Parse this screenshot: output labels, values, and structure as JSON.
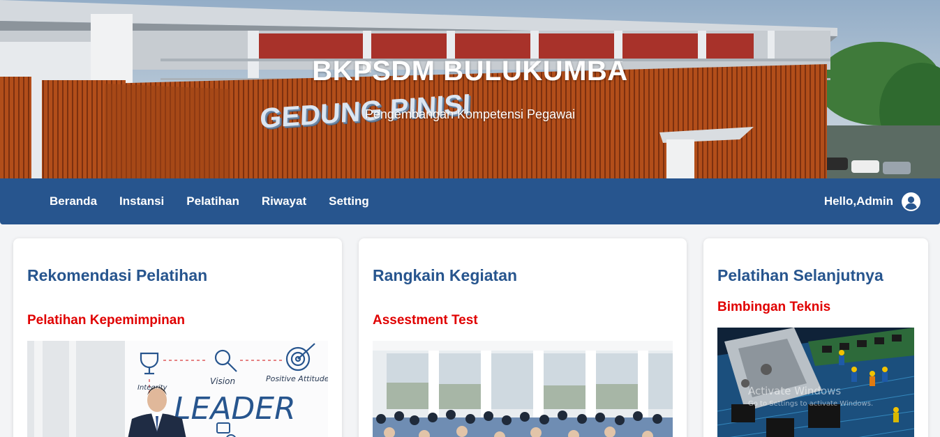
{
  "hero": {
    "title": "BKPSDM BULUKUMBA",
    "subtitle": "Pengembangan Kompetensi Pegawai",
    "building_sign": "GEDUNG PINISI"
  },
  "navbar": {
    "background": "#27558e",
    "links": [
      {
        "label": "Beranda"
      },
      {
        "label": "Instansi"
      },
      {
        "label": "Pelatihan"
      },
      {
        "label": "Riwayat"
      },
      {
        "label": "Setting"
      }
    ],
    "user_greeting": "Hello,Admin",
    "user_icon": "user-circle-icon"
  },
  "cards": [
    {
      "title": "Rekomendasi Pelatihan",
      "subtitle": "Pelatihan Kepemimpinan",
      "image": {
        "word": "LEADER",
        "labels": [
          "Vision",
          "Positive Attitude",
          "Integrity"
        ]
      }
    },
    {
      "title": "Rangkain Kegiatan",
      "subtitle": "Assestment Test",
      "image": {}
    },
    {
      "title": "Pelatihan Selanjutnya",
      "subtitle": "Bimbingan Teknis",
      "image": {}
    }
  ],
  "watermark": {
    "line1": "Activate Windows",
    "line2": "Go to Settings to activate Windows."
  },
  "colors": {
    "title_blue": "#27558e",
    "subtitle_red": "#e00000"
  }
}
